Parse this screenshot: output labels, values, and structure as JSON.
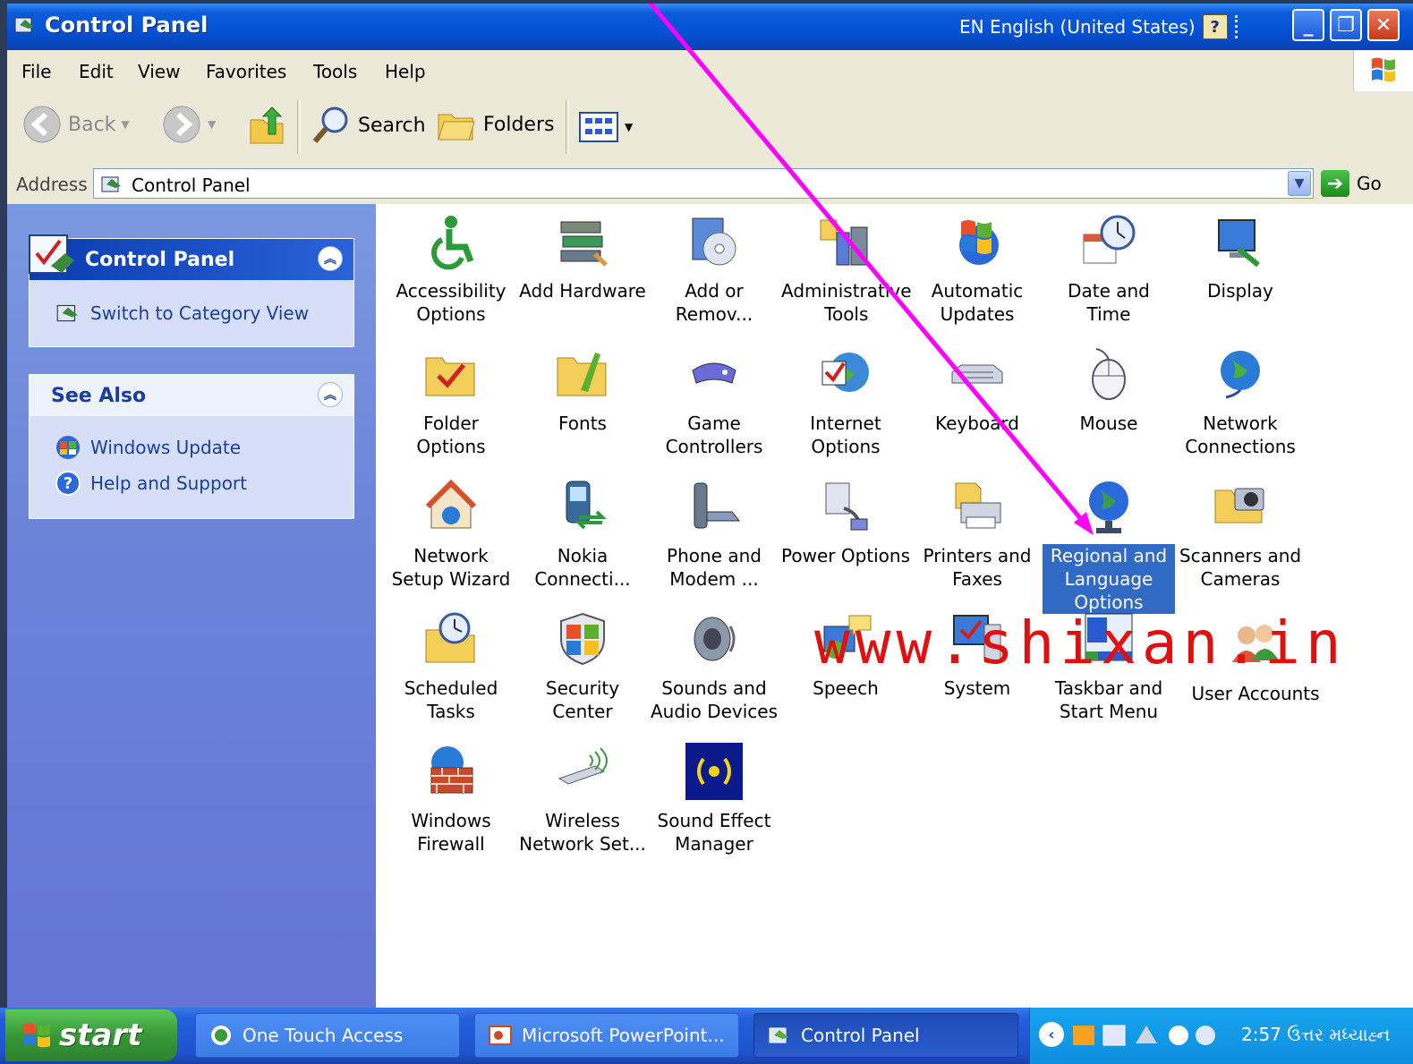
{
  "window": {
    "title": "Control Panel",
    "language": "EN English (United States)",
    "help_glyph": "?",
    "minimize_glyph": "_",
    "restore_glyph": "❐",
    "close_glyph": "✕"
  },
  "menu": [
    "File",
    "Edit",
    "View",
    "Favorites",
    "Tools",
    "Help"
  ],
  "toolbar": {
    "back": "Back",
    "search": "Search",
    "folders": "Folders"
  },
  "address": {
    "label": "Address",
    "value": "Control Panel",
    "go": "Go"
  },
  "sidebar": {
    "panel_title": "Control Panel",
    "switch_link": "Switch to Category View",
    "see_also_title": "See Also",
    "see_also_links": [
      "Windows Update",
      "Help and Support"
    ]
  },
  "items": [
    {
      "label": "Accessibility Options",
      "icon": "accessibility-icon"
    },
    {
      "label": "Add Hardware",
      "icon": "add-hardware-icon"
    },
    {
      "label": "Add or Remov...",
      "icon": "add-remove-programs-icon"
    },
    {
      "label": "Administrative Tools",
      "icon": "administrative-tools-icon"
    },
    {
      "label": "Automatic Updates",
      "icon": "automatic-updates-icon"
    },
    {
      "label": "Date and Time",
      "icon": "date-time-icon"
    },
    {
      "label": "Display",
      "icon": "display-icon"
    },
    {
      "label": "Folder Options",
      "icon": "folder-options-icon"
    },
    {
      "label": "Fonts",
      "icon": "fonts-folder-icon"
    },
    {
      "label": "Game Controllers",
      "icon": "game-controller-icon"
    },
    {
      "label": "Internet Options",
      "icon": "internet-options-icon"
    },
    {
      "label": "Keyboard",
      "icon": "keyboard-icon"
    },
    {
      "label": "Mouse",
      "icon": "mouse-icon"
    },
    {
      "label": "Network Connections",
      "icon": "network-globe-icon"
    },
    {
      "label": "Network Setup Wizard",
      "icon": "network-house-icon"
    },
    {
      "label": "Nokia Connecti...",
      "icon": "phone-sync-icon"
    },
    {
      "label": "Phone and Modem ...",
      "icon": "phone-modem-icon"
    },
    {
      "label": "Power Options",
      "icon": "power-plug-icon"
    },
    {
      "label": "Printers and Faxes",
      "icon": "printer-icon"
    },
    {
      "label": "Regional and Language Options",
      "icon": "globe-icon"
    },
    {
      "label": "Scanners and Cameras",
      "icon": "camera-icon"
    },
    {
      "label": "Scheduled Tasks",
      "icon": "scheduled-tasks-icon"
    },
    {
      "label": "Security Center",
      "icon": "shield-icon"
    },
    {
      "label": "Sounds and Audio Devices",
      "icon": "speaker-icon"
    },
    {
      "label": "Speech",
      "icon": "speech-icon"
    },
    {
      "label": "System",
      "icon": "system-icon"
    },
    {
      "label": "Taskbar and Start Menu",
      "icon": "taskbar-icon"
    },
    {
      "label": "User Accounts",
      "icon": "users-icon"
    },
    {
      "label": "Windows Firewall",
      "icon": "firewall-icon"
    },
    {
      "label": "Wireless Network Set...",
      "icon": "wireless-icon"
    },
    {
      "label": "Sound Effect Manager",
      "icon": "sound-effect-icon"
    }
  ],
  "selected_item": "Regional and Language Options",
  "watermark": "www.shixan.in",
  "taskbar": {
    "start": "start",
    "tasks": [
      "One Touch Access",
      "Microsoft PowerPoint...",
      "Control Panel"
    ],
    "clock": "2:57 ઉત્તર મધ્યાહ્ન"
  },
  "colors": {
    "title_bar": "#0551d6",
    "selection": "#316ac5",
    "sidebar": "#6b84d8",
    "watermark": "#e01010",
    "annotation_arrow": "#ff00ff"
  }
}
